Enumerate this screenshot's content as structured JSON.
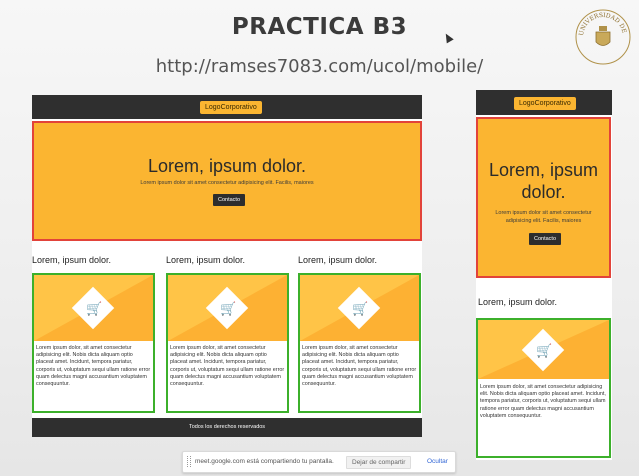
{
  "slide": {
    "title": "PRACTICA B3",
    "url": "http://ramses7083.com/ucol/mobile/"
  },
  "seal": {
    "icon": "university-seal-icon",
    "text": "UNIVERSIDAD DE COLIMA"
  },
  "desktop": {
    "logo": "LogoCorporativo",
    "hero": {
      "title": "Lorem, ipsum dolor.",
      "text": "Lorem ipsum dolor sit amet consectetur adipisicing elit. Facilis, maiores",
      "button": "Contacto"
    },
    "sections": [
      {
        "heading": "Lorem, ipsum dolor.",
        "icon": "shopping-cart-icon",
        "text": "Lorem ipsum dolor, sit amet consectetur adipisicing elit. Nobis dicta aliquam optio placeat amet. Incidunt, tempora pariatur, corporis ut, voluptatum sequi ullam ratione error quam delectus magni accusantium voluptatem consequuntur."
      },
      {
        "heading": "Lorem, ipsum dolor.",
        "icon": "shopping-cart-icon",
        "text": "Lorem ipsum dolor, sit amet consectetur adipisicing elit. Nobis dicta aliquam optio placeat amet. Incidunt, tempora pariatur, corporis ut, voluptatum sequi ullam ratione error quam delectus magni accusantium voluptatem consequuntur."
      },
      {
        "heading": "Lorem, ipsum dolor.",
        "icon": "shopping-cart-icon",
        "text": "Lorem ipsum dolor, sit amet consectetur adipisicing elit. Nobis dicta aliquam optio placeat amet. Incidunt, tempora pariatur, corporis ut, voluptatum sequi ullam ratione error quam delectus magni accusantium voluptatem consequuntur."
      }
    ],
    "footer": "Todos los derechos reservados"
  },
  "mobile": {
    "logo": "LogoCorporativo",
    "hero": {
      "title": "Lorem, ipsum dolor.",
      "text": "Lorem ipsum dolor sit amet consectetur adipisicing elit. Facilis, maiores",
      "button": "Contacto"
    },
    "section": {
      "heading": "Lorem, ipsum dolor.",
      "icon": "shopping-cart-icon",
      "text": "Lorem ipsum dolor, sit amet consectetur adipisicing elit. Nobis dicta aliquam optio placeat amet. Incidunt, tempora pariatur, corporis ut, voluptatum sequi ullam ratione error quam delectus magni accusantium voluptatem consequuntur."
    }
  },
  "share_bar": {
    "message": "meet.google.com está compartiendo tu pantalla.",
    "stop_label": "Dejar de compartir",
    "hide_label": "Ocultar"
  },
  "colors": {
    "accent_yellow": "#fbb531",
    "hero_border": "#e2433a",
    "card_border": "#3cb02b",
    "navbar": "#2f2f2f"
  }
}
